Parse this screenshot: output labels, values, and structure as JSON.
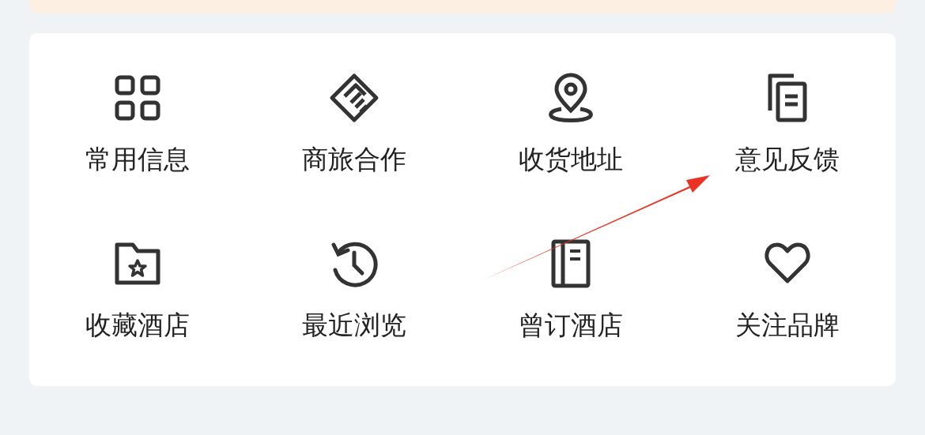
{
  "banner": {
    "kind": "strip"
  },
  "menu": [
    {
      "label": "常用信息"
    },
    {
      "label": "商旅合作"
    },
    {
      "label": "收货地址"
    },
    {
      "label": "意见反馈"
    },
    {
      "label": "收藏酒店"
    },
    {
      "label": "最近浏览"
    },
    {
      "label": "曾订酒店"
    },
    {
      "label": "关注品牌"
    }
  ],
  "annotation": {
    "kind": "arrow"
  }
}
